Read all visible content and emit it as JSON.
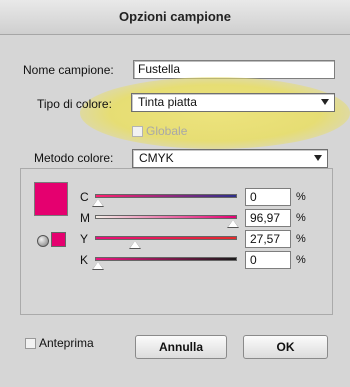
{
  "window": {
    "title": "Opzioni campione"
  },
  "form": {
    "name_label": "Nome campione:",
    "name_value": "Fustella",
    "color_type_label": "Tipo di colore:",
    "color_type_value": "Tinta piatta",
    "global_label": "Globale",
    "global_checked": false
  },
  "color_mode": {
    "label": "Metodo colore:",
    "value": "CMYK",
    "swatch_color": "#e5006f",
    "channels": [
      {
        "name": "C",
        "value": "0",
        "level": 0,
        "gradient": [
          "#ff1f70",
          "#2d2f8a"
        ]
      },
      {
        "name": "M",
        "value": "96,97",
        "level": 0.9697,
        "gradient": [
          "#f3ede6",
          "#e40073"
        ]
      },
      {
        "name": "Y",
        "value": "27,57",
        "level": 0.2757,
        "gradient": [
          "#e80e7a",
          "#e32a2a"
        ]
      },
      {
        "name": "K",
        "value": "0",
        "level": 0,
        "gradient": [
          "#ea157f",
          "#1a1a1a"
        ]
      }
    ],
    "percent_sign": "%"
  },
  "footer": {
    "preview_label": "Anteprima",
    "preview_checked": false,
    "cancel_label": "Annulla",
    "ok_label": "OK"
  }
}
